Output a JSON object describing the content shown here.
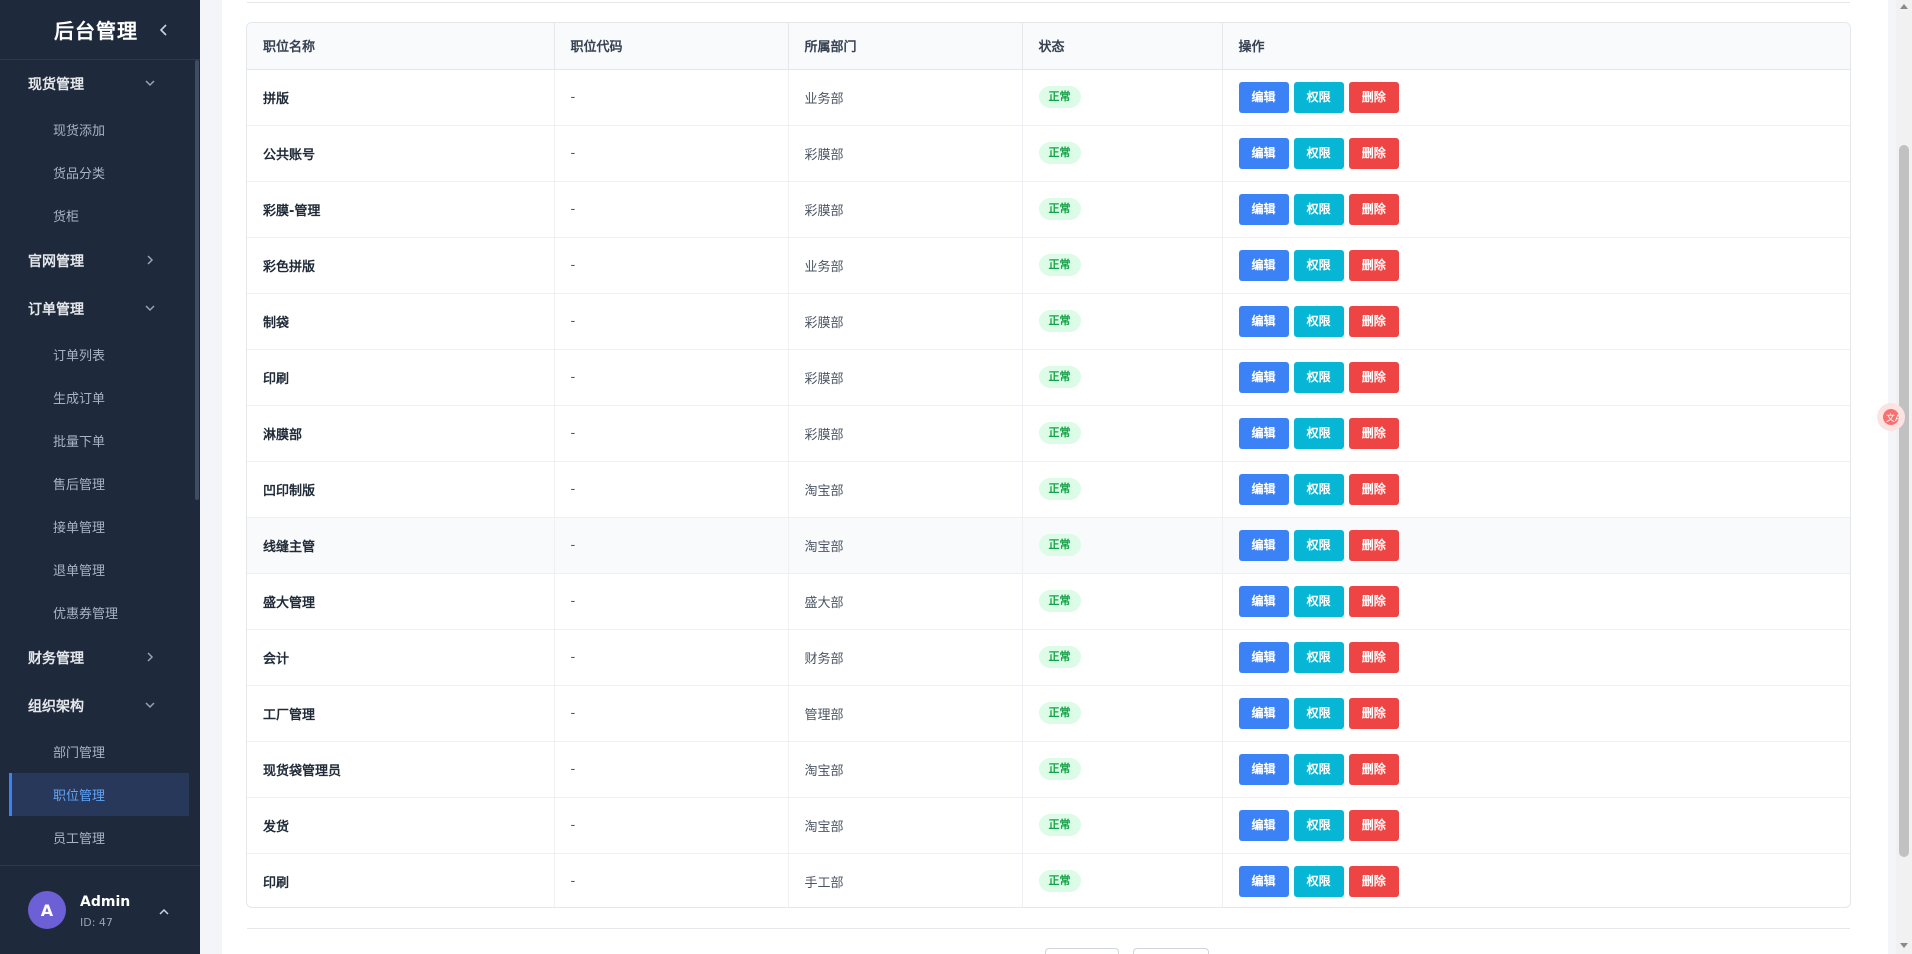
{
  "app": {
    "title": "后台管理"
  },
  "sidebar": {
    "groups": [
      {
        "label": "现货管理",
        "expanded": true,
        "items": [
          "现货添加",
          "货品分类",
          "货柜"
        ]
      },
      {
        "label": "官网管理",
        "expanded": false,
        "items": []
      },
      {
        "label": "订单管理",
        "expanded": true,
        "items": [
          "订单列表",
          "生成订单",
          "批量下单",
          "售后管理",
          "接单管理",
          "退单管理",
          "优惠券管理"
        ]
      },
      {
        "label": "财务管理",
        "expanded": false,
        "items": []
      },
      {
        "label": "组织架构",
        "expanded": true,
        "items": [
          "部门管理",
          "职位管理",
          "员工管理"
        ]
      }
    ],
    "active_item": "职位管理",
    "user": {
      "avatar_letter": "A",
      "name": "Admin",
      "id": "ID: 47"
    }
  },
  "table": {
    "columns": [
      "职位名称",
      "职位代码",
      "所属部门",
      "状态",
      "操作"
    ],
    "actions": {
      "edit": "编辑",
      "perm": "权限",
      "delete": "删除"
    },
    "rows": [
      {
        "name": "拼版",
        "code": "-",
        "dept": "业务部",
        "status": "正常"
      },
      {
        "name": "公共账号",
        "code": "-",
        "dept": "彩膜部",
        "status": "正常"
      },
      {
        "name": "彩膜-管理",
        "code": "-",
        "dept": "彩膜部",
        "status": "正常"
      },
      {
        "name": "彩色拼版",
        "code": "-",
        "dept": "业务部",
        "status": "正常"
      },
      {
        "name": "制袋",
        "code": "-",
        "dept": "彩膜部",
        "status": "正常"
      },
      {
        "name": "印刷",
        "code": "-",
        "dept": "彩膜部",
        "status": "正常"
      },
      {
        "name": "淋膜部",
        "code": "-",
        "dept": "彩膜部",
        "status": "正常"
      },
      {
        "name": "凹印制版",
        "code": "-",
        "dept": "淘宝部",
        "status": "正常"
      },
      {
        "name": "线缝主管",
        "code": "-",
        "dept": "淘宝部",
        "status": "正常"
      },
      {
        "name": "盛大管理",
        "code": "-",
        "dept": "盛大部",
        "status": "正常"
      },
      {
        "name": "会计",
        "code": "-",
        "dept": "财务部",
        "status": "正常"
      },
      {
        "name": "工厂管理",
        "code": "-",
        "dept": "管理部",
        "status": "正常"
      },
      {
        "name": "现货袋管理员",
        "code": "-",
        "dept": "淘宝部",
        "status": "正常"
      },
      {
        "name": "发货",
        "code": "-",
        "dept": "淘宝部",
        "status": "正常"
      },
      {
        "name": "印刷",
        "code": "-",
        "dept": "手工部",
        "status": "正常"
      }
    ]
  },
  "icons": {
    "collapse": "chevron-left-icon",
    "expanded": "chevron-down-icon",
    "collapsed": "chevron-right-icon",
    "user_menu": "chevron-up-icon",
    "floating": "translate-icon"
  },
  "colors": {
    "sidebar_bg": "#1e293b",
    "active_text": "#60a5fa",
    "edit": "#3b82f6",
    "perm": "#06b6d4",
    "delete": "#ef4444",
    "status_ok": "#16a34a"
  }
}
